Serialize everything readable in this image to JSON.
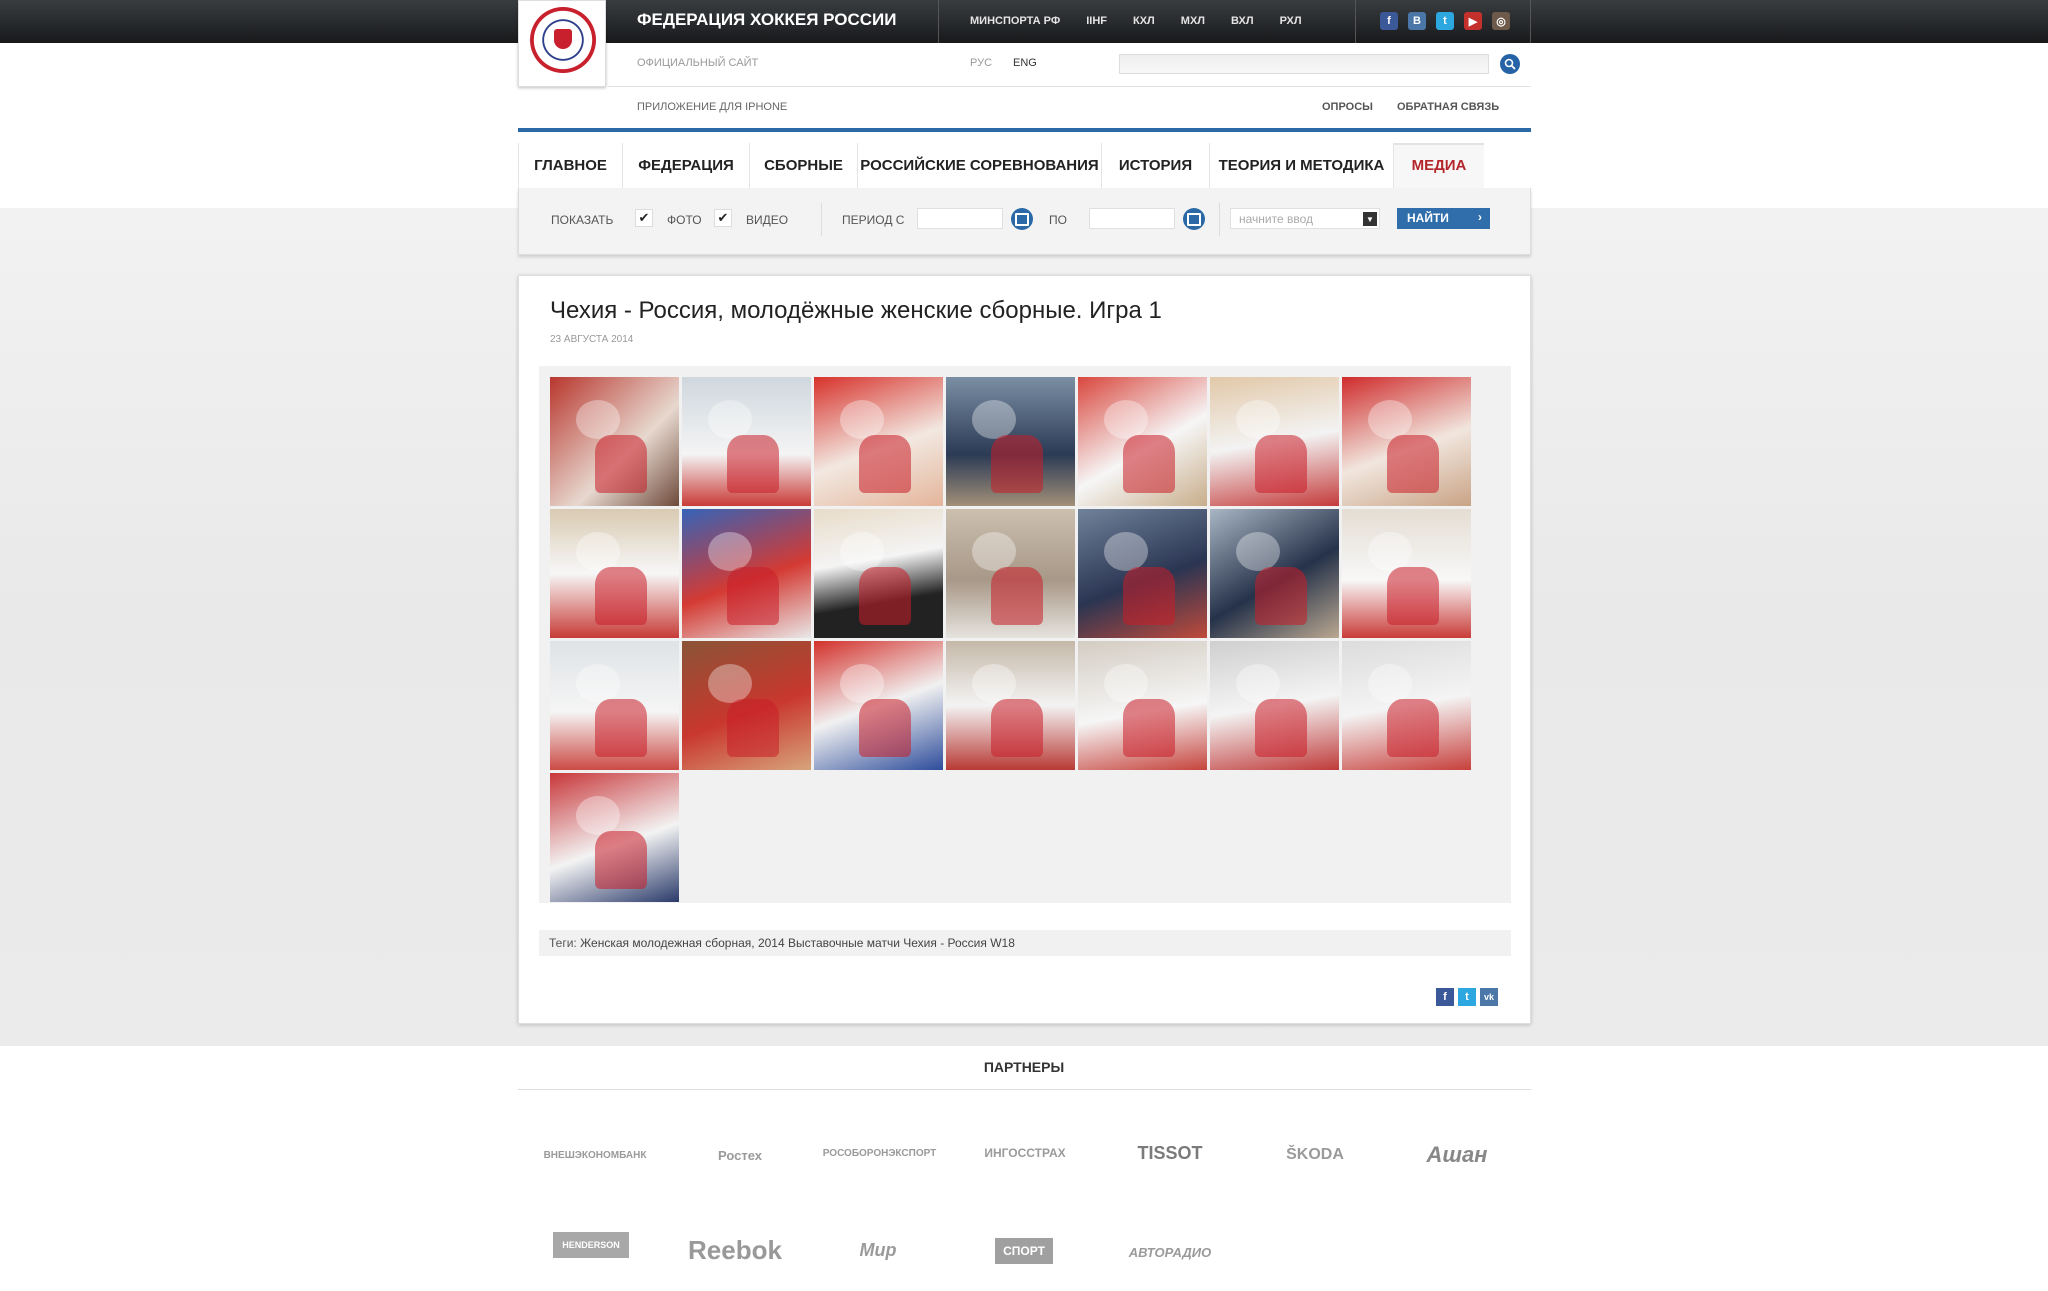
{
  "header": {
    "title": "ФЕДЕРАЦИЯ ХОККЕЯ РОССИИ",
    "links": [
      "МИНСПОРТА РФ",
      "IIHF",
      "КХЛ",
      "МХЛ",
      "ВХЛ",
      "РХЛ"
    ],
    "social": [
      {
        "icon": "facebook-icon",
        "glyph": "f",
        "color": "#3b5998"
      },
      {
        "icon": "vkontakte-icon",
        "glyph": "B",
        "color": "#4a76a8"
      },
      {
        "icon": "twitter-icon",
        "glyph": "t",
        "color": "#2ca7e0"
      },
      {
        "icon": "youtube-icon",
        "glyph": "▶",
        "color": "#c4302b"
      },
      {
        "icon": "instagram-icon",
        "glyph": "◎",
        "color": "#6d5a4a"
      }
    ],
    "tagline": "ОФИЦИАЛЬНЫЙ САЙТ",
    "lang_ru": "РУС",
    "lang_en": "ENG",
    "iphone_app": "ПРИЛОЖЕНИЕ ДЛЯ IPHONE",
    "polls": "ОПРОСЫ",
    "feedback": "ОБРАТНАЯ СВЯЗЬ"
  },
  "nav": {
    "items": [
      "ГЛАВНОЕ",
      "ФЕДЕРАЦИЯ",
      "СБОРНЫЕ",
      "РОССИЙСКИЕ СОРЕВНОВАНИЯ",
      "ИСТОРИЯ",
      "ТЕОРИЯ И МЕТОДИКА",
      "МЕДИА"
    ],
    "active": "МЕДИА"
  },
  "filter": {
    "show_label": "ПОКАЗАТЬ",
    "photo_label": "ФОТО",
    "video_label": "ВИДЕО",
    "period_from": "ПЕРИОД С",
    "period_to": "ПО",
    "search_placeholder": "начните ввод",
    "find_button": "НАЙТИ"
  },
  "article": {
    "title": "Чехия - Россия, молодёжные женские сборные. Игра 1",
    "date": "23 АВГУСТА 2014",
    "tags_label": "Теги:",
    "tags": "Женская молодежная сборная, 2014 Выставочные матчи Чехия - Россия W18",
    "photo_count": 22
  },
  "share": [
    {
      "icon": "facebook-share-icon",
      "glyph": "f",
      "color": "#3b5998"
    },
    {
      "icon": "twitter-share-icon",
      "glyph": "t",
      "color": "#2ca7e0"
    },
    {
      "icon": "vkontakte-share-icon",
      "glyph": "vk",
      "color": "#4a76a8"
    }
  ],
  "partners": {
    "title": "ПАРТНЕРЫ",
    "logos": [
      "ВНЕШЭКОНОМБАНК",
      "Ростех",
      "РОСОБОРОНЭКСПОРТ",
      "ИНГОССТРАХ",
      "TISSOT",
      "ŠKODA",
      "Ашан",
      "HENDERSON",
      "Reebok",
      "Мир",
      "СПОРТ",
      "АВТОРАДИО"
    ]
  }
}
